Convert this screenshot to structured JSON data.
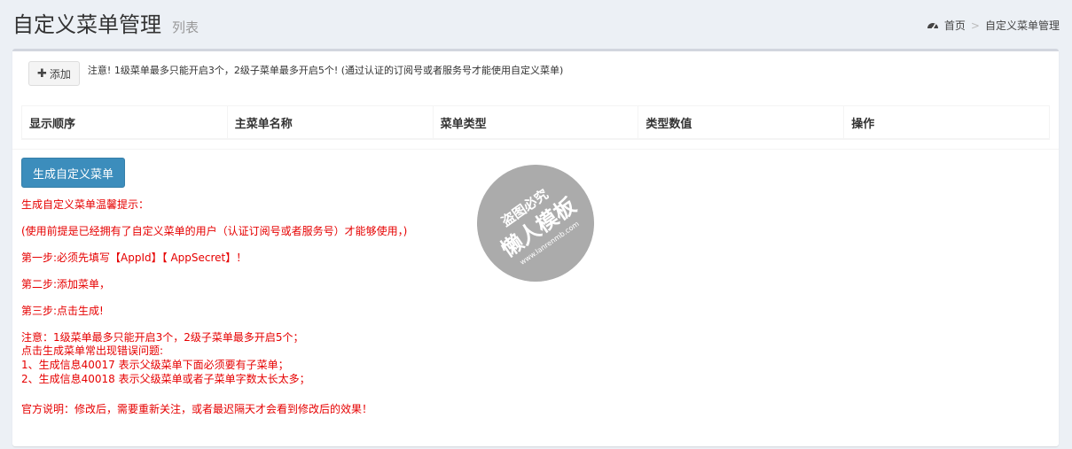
{
  "header": {
    "title": "自定义菜单管理",
    "subtitle": "列表",
    "breadcrumb": {
      "home": "首页",
      "separator": ">",
      "current": "自定义菜单管理"
    },
    "home_icon": "dashboard-icon"
  },
  "toolbar": {
    "add_label": "添加",
    "add_icon": "plus-icon",
    "note": "注意! 1级菜单最多只能开启3个，2级子菜单最多开启5个! (通过认证的订阅号或者服务号才能使用自定义菜单)"
  },
  "table": {
    "columns": [
      "显示顺序",
      "主菜单名称",
      "菜单类型",
      "类型数值",
      "操作"
    ]
  },
  "generate_button": {
    "label": "生成自定义菜单",
    "color": "#3c8dbc"
  },
  "tips": {
    "color": "#e60000",
    "lines": [
      "生成自定义菜单温馨提示：",
      "(使用前提是已经拥有了自定义菜单的用户（认证订阅号或者服务号）才能够使用，)",
      "第一步:必须先填写【AppId】【 AppSecret】！",
      "第二步:添加菜单，",
      "第三步:点击生成!",
      "注意：1级菜单最多只能开启3个，2级子菜单最多开启5个；",
      "点击生成菜单常出现错误问题:",
      "1、生成信息40017 表示父级菜单下面必须要有子菜单；",
      "2、生成信息40018 表示父级菜单或者子菜单字数太长太多；",
      "官方说明：修改后，需要重新关注，或者最迟隔天才会看到修改后的效果！"
    ]
  },
  "watermark": {
    "line1": "盗图必究",
    "line2": "懒人模板",
    "line3": "www.lanrenmb.com"
  }
}
